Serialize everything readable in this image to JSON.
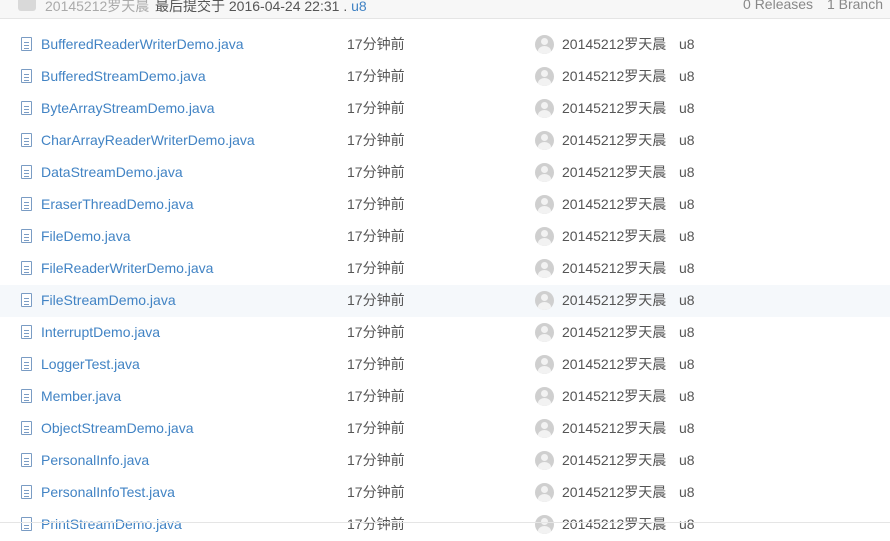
{
  "commit_bar": {
    "author": "20145212罗天晨",
    "message": "最后提交于 2016-04-24 22:31 . ",
    "hash": "u8",
    "releases": "0 Releases",
    "branches": "1 Branch"
  },
  "files": [
    {
      "name": "BufferedReaderWriterDemo.java",
      "time": "17分钟前",
      "user": "20145212罗天晨",
      "commit": "u8"
    },
    {
      "name": "BufferedStreamDemo.java",
      "time": "17分钟前",
      "user": "20145212罗天晨",
      "commit": "u8"
    },
    {
      "name": "ByteArrayStreamDemo.java",
      "time": "17分钟前",
      "user": "20145212罗天晨",
      "commit": "u8"
    },
    {
      "name": "CharArrayReaderWriterDemo.java",
      "time": "17分钟前",
      "user": "20145212罗天晨",
      "commit": "u8"
    },
    {
      "name": "DataStreamDemo.java",
      "time": "17分钟前",
      "user": "20145212罗天晨",
      "commit": "u8"
    },
    {
      "name": "EraserThreadDemo.java",
      "time": "17分钟前",
      "user": "20145212罗天晨",
      "commit": "u8"
    },
    {
      "name": "FileDemo.java",
      "time": "17分钟前",
      "user": "20145212罗天晨",
      "commit": "u8"
    },
    {
      "name": "FileReaderWriterDemo.java",
      "time": "17分钟前",
      "user": "20145212罗天晨",
      "commit": "u8"
    },
    {
      "name": "FileStreamDemo.java",
      "time": "17分钟前",
      "user": "20145212罗天晨",
      "commit": "u8"
    },
    {
      "name": "InterruptDemo.java",
      "time": "17分钟前",
      "user": "20145212罗天晨",
      "commit": "u8"
    },
    {
      "name": "LoggerTest.java",
      "time": "17分钟前",
      "user": "20145212罗天晨",
      "commit": "u8"
    },
    {
      "name": "Member.java",
      "time": "17分钟前",
      "user": "20145212罗天晨",
      "commit": "u8"
    },
    {
      "name": "ObjectStreamDemo.java",
      "time": "17分钟前",
      "user": "20145212罗天晨",
      "commit": "u8"
    },
    {
      "name": "PersonalInfo.java",
      "time": "17分钟前",
      "user": "20145212罗天晨",
      "commit": "u8"
    },
    {
      "name": "PersonalInfoTest.java",
      "time": "17分钟前",
      "user": "20145212罗天晨",
      "commit": "u8"
    },
    {
      "name": "PrintStreamDemo.java",
      "time": "17分钟前",
      "user": "20145212罗天晨",
      "commit": "u8"
    }
  ],
  "highlighted_row": 8,
  "icons": {
    "file": "file-icon",
    "avatar": "user-avatar-icon"
  }
}
